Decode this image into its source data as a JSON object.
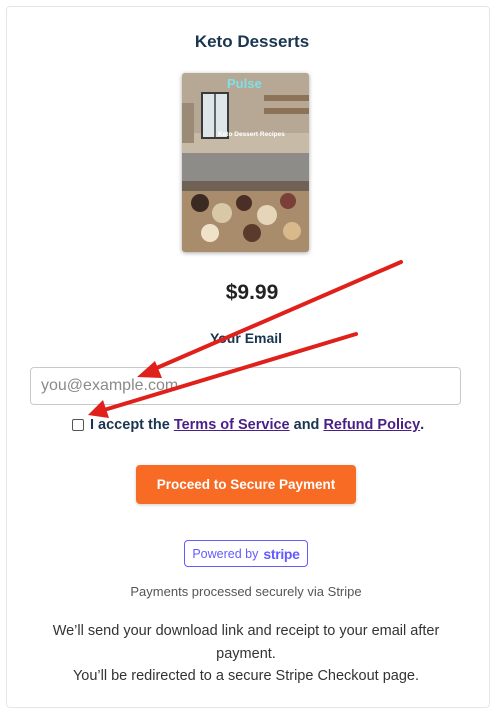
{
  "product": {
    "title": "Keto Desserts",
    "price": "$9.99",
    "cover": {
      "brand_text": "Pulse",
      "heading": "Keto Dessert Recipes"
    }
  },
  "form": {
    "email_label": "Your Email",
    "email_placeholder": "you@example.com",
    "email_value": "",
    "terms_prefix": "I accept the",
    "terms_link": "Terms of Service",
    "terms_and": "and",
    "refund_link": "Refund Policy",
    "terms_suffix": ".",
    "pay_button": "Proceed to Secure Payment"
  },
  "stripe": {
    "powered_by": "Powered by",
    "brand": "stripe",
    "note": "Payments processed securely via Stripe"
  },
  "info": {
    "line1": "We’ll send your download link and receipt to your email after payment.",
    "line2": "You’ll be redirected to a secure Stripe Checkout page."
  },
  "colors": {
    "accent": "#f76b25",
    "stripe": "#635bff",
    "heading": "#1a3550",
    "link": "#4a1f86",
    "annotation_arrow": "#e0201b"
  },
  "annotations": [
    {
      "type": "arrow",
      "target": "email-input"
    },
    {
      "type": "arrow",
      "target": "terms-checkbox"
    }
  ]
}
